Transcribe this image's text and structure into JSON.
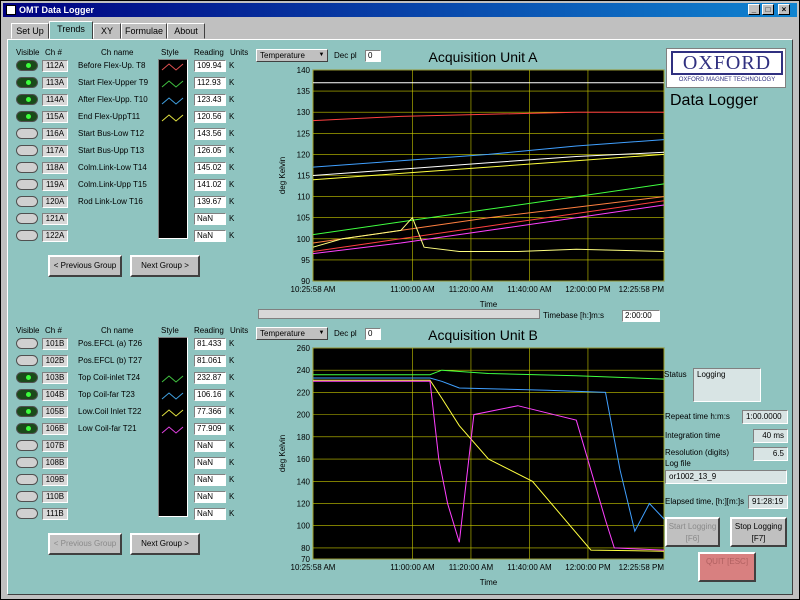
{
  "window": {
    "title": "OMT Data Logger"
  },
  "tabs": [
    "Set Up",
    "Trends",
    "XY",
    "Formulae",
    "About"
  ],
  "headers": {
    "visible": "Visible",
    "ch": "Ch #",
    "name": "Ch name",
    "style": "Style",
    "reading": "Reading",
    "units": "Units"
  },
  "groupA": {
    "rows": [
      {
        "on": true,
        "ch": "112A",
        "name": "Before Flex-Up. T8",
        "reading": "109.94",
        "units": "K",
        "color": "#e05050"
      },
      {
        "on": true,
        "ch": "113A",
        "name": "Start Flex-Upper T9",
        "reading": "112.93",
        "units": "K",
        "color": "#40c040"
      },
      {
        "on": true,
        "ch": "114A",
        "name": "After Flex-Upp. T10",
        "reading": "123.43",
        "units": "K",
        "color": "#40a0e0"
      },
      {
        "on": true,
        "ch": "115A",
        "name": "End Flex-UppT11",
        "reading": "120.56",
        "units": "K",
        "color": "#e0e040"
      },
      {
        "on": false,
        "ch": "116A",
        "name": "Start Bus-Low T12",
        "reading": "143.56",
        "units": "K",
        "color": ""
      },
      {
        "on": false,
        "ch": "117A",
        "name": "Start Bus-Upp T13",
        "reading": "126.05",
        "units": "K",
        "color": ""
      },
      {
        "on": false,
        "ch": "118A",
        "name": "Colm.Link-Low T14",
        "reading": "145.02",
        "units": "K",
        "color": ""
      },
      {
        "on": false,
        "ch": "119A",
        "name": "Colm.Link-Upp T15",
        "reading": "141.02",
        "units": "K",
        "color": ""
      },
      {
        "on": false,
        "ch": "120A",
        "name": "Rod Link-Low T16",
        "reading": "139.67",
        "units": "K",
        "color": ""
      },
      {
        "on": false,
        "ch": "121A",
        "name": "",
        "reading": "NaN",
        "units": "K",
        "color": ""
      },
      {
        "on": false,
        "ch": "122A",
        "name": "",
        "reading": "NaN",
        "units": "K",
        "color": ""
      }
    ],
    "prev_label": "< Previous Group",
    "next_label": "Next Group >"
  },
  "groupB": {
    "rows": [
      {
        "on": false,
        "ch": "101B",
        "name": "Pos.EFCL (a) T26",
        "reading": "81.433",
        "units": "K",
        "color": ""
      },
      {
        "on": false,
        "ch": "102B",
        "name": "Pos.EFCL (b) T27",
        "reading": "81.061",
        "units": "K",
        "color": ""
      },
      {
        "on": true,
        "ch": "103B",
        "name": "Top Coil-inlet T24",
        "reading": "232.87",
        "units": "K",
        "color": "#40c040"
      },
      {
        "on": true,
        "ch": "104B",
        "name": "Top Coil-far T23",
        "reading": "106.16",
        "units": "K",
        "color": "#40a0e0"
      },
      {
        "on": true,
        "ch": "105B",
        "name": "Low.Coil Inlet T22",
        "reading": "77.366",
        "units": "K",
        "color": "#e0e040"
      },
      {
        "on": true,
        "ch": "106B",
        "name": "Low Coil-far T21",
        "reading": "77.909",
        "units": "K",
        "color": "#e040e0"
      },
      {
        "on": false,
        "ch": "107B",
        "name": "",
        "reading": "NaN",
        "units": "K",
        "color": ""
      },
      {
        "on": false,
        "ch": "108B",
        "name": "",
        "reading": "NaN",
        "units": "K",
        "color": ""
      },
      {
        "on": false,
        "ch": "109B",
        "name": "",
        "reading": "NaN",
        "units": "K",
        "color": ""
      },
      {
        "on": false,
        "ch": "110B",
        "name": "",
        "reading": "NaN",
        "units": "K",
        "color": ""
      },
      {
        "on": false,
        "ch": "111B",
        "name": "",
        "reading": "NaN",
        "units": "K",
        "color": ""
      }
    ],
    "prev_label": "< Previous Group",
    "next_label": "Next Group >"
  },
  "controls": {
    "quantity": "Temperature",
    "dec_label": "Dec pl",
    "dec_value": "0",
    "timebase_label": "Timebase [h:]m:s",
    "timebase_value": "2:00:00"
  },
  "chart_data": [
    {
      "type": "line",
      "title": "Acquisition Unit A",
      "xlabel": "Time",
      "ylabel": "deg Kelvin",
      "ylim": [
        90,
        140
      ],
      "yticks": [
        90,
        95,
        100,
        105,
        110,
        115,
        120,
        125,
        130,
        135,
        140
      ],
      "xticks": [
        "10:25:58 AM",
        "11:00:00 AM",
        "11:20:00 AM",
        "11:40:00 AM",
        "12:00:00 PM",
        "12:25:58 PM"
      ],
      "xminutes": [
        0,
        34,
        54,
        74,
        94,
        120
      ],
      "series": [
        {
          "color": "#ffffff",
          "x": [
            0,
            60,
            120
          ],
          "y": [
            137,
            137,
            137
          ]
        },
        {
          "color": "#ff4040",
          "x": [
            0,
            30,
            60,
            90,
            120
          ],
          "y": [
            128,
            129,
            129.5,
            130,
            130
          ]
        },
        {
          "color": "#40a0ff",
          "x": [
            0,
            30,
            60,
            90,
            120
          ],
          "y": [
            117,
            118.5,
            120,
            122,
            123.5
          ]
        },
        {
          "color": "#ffffff",
          "x": [
            0,
            30,
            60,
            90,
            120
          ],
          "y": [
            115,
            116.5,
            118,
            119.5,
            120.5
          ]
        },
        {
          "color": "#ffff40",
          "x": [
            0,
            30,
            60,
            90,
            120
          ],
          "y": [
            114,
            115.5,
            117,
            118.5,
            120
          ]
        },
        {
          "color": "#40ff40",
          "x": [
            0,
            30,
            60,
            90,
            120
          ],
          "y": [
            101,
            104,
            107,
            110,
            113
          ]
        },
        {
          "color": "#ff8040",
          "x": [
            0,
            30,
            60,
            90,
            120
          ],
          "y": [
            99,
            102,
            105,
            107.5,
            110
          ]
        },
        {
          "color": "#ff4040",
          "x": [
            0,
            30,
            60,
            90,
            120
          ],
          "y": [
            97,
            100,
            103,
            106,
            109
          ]
        },
        {
          "color": "#ff40ff",
          "x": [
            0,
            30,
            60,
            90,
            120
          ],
          "y": [
            96.5,
            99,
            102,
            105,
            108
          ]
        },
        {
          "color": "#ffff80",
          "x": [
            0,
            10,
            20,
            30,
            34,
            38,
            50,
            70,
            90,
            120
          ],
          "y": [
            98,
            100,
            101,
            102,
            105,
            98,
            97,
            97,
            97.5,
            97
          ]
        }
      ]
    },
    {
      "type": "line",
      "title": "Acquisition Unit B",
      "xlabel": "Time",
      "ylabel": "deg Kelvin",
      "ylim": [
        70,
        260
      ],
      "yticks": [
        70,
        80,
        100,
        120,
        140,
        160,
        180,
        200,
        220,
        240,
        260
      ],
      "xticks": [
        "10:25:58 AM",
        "11:00:00 AM",
        "11:20:00 AM",
        "11:40:00 AM",
        "12:00:00 PM",
        "12:25:58 PM"
      ],
      "xminutes": [
        0,
        34,
        54,
        74,
        94,
        120
      ],
      "series": [
        {
          "color": "#40ff40",
          "x": [
            0,
            40,
            44,
            60,
            90,
            120
          ],
          "y": [
            236,
            236,
            240,
            237,
            235,
            232
          ]
        },
        {
          "color": "#40a0ff",
          "x": [
            0,
            40,
            44,
            50,
            80,
            100,
            105,
            110,
            115,
            120
          ],
          "y": [
            233,
            233,
            230,
            224,
            222,
            220,
            150,
            95,
            120,
            106
          ]
        },
        {
          "color": "#ffff40",
          "x": [
            0,
            40,
            44,
            50,
            60,
            75,
            95,
            120
          ],
          "y": [
            231,
            231,
            215,
            190,
            160,
            140,
            78,
            77
          ]
        },
        {
          "color": "#ff40ff",
          "x": [
            0,
            40,
            43,
            46,
            50,
            55,
            70,
            90,
            100,
            103,
            120
          ],
          "y": [
            230,
            230,
            160,
            120,
            85,
            200,
            208,
            195,
            105,
            80,
            78
          ]
        }
      ]
    }
  ],
  "logo": {
    "name": "OXFORD",
    "sub": "OXFORD MAGNET TECHNOLOGY"
  },
  "app_title": "Data Logger",
  "status": {
    "label": "Status",
    "value": "Logging",
    "repeat_label": "Repeat time h:m:s",
    "repeat_value": "1:00.0000",
    "integration_label": "Integration time",
    "integration_value": "40 ms",
    "resolution_label": "Resolution (digits)",
    "resolution_value": "6.5",
    "logfile_label": "Log file",
    "logfile_value": "or1002_13_9",
    "elapsed_label": "Elapsed time, [h:][m:]s",
    "elapsed_value": "91:28:19"
  },
  "buttons": {
    "start": "Start Logging [F6]",
    "stop": "Stop Logging [F7]",
    "quit": "QUIT [ESC]"
  },
  "colors": {
    "panel": "#8fc4c0",
    "plot_bg": "#000000",
    "grid": "#c8c800",
    "quit": "#d88080"
  }
}
